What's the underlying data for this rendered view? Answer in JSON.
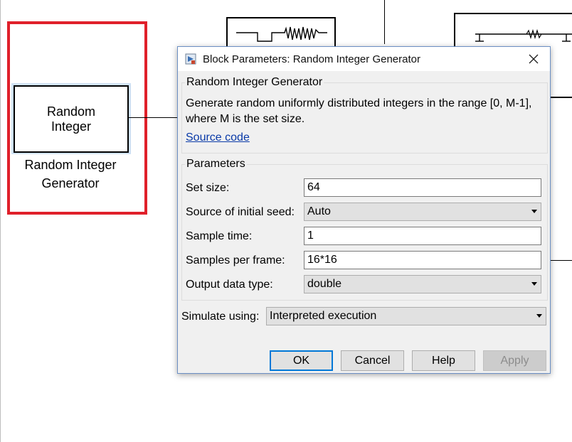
{
  "model_canvas": {
    "block": {
      "label": "Random\nInteger",
      "caption": "Random Integer\nGenerator"
    }
  },
  "dialog": {
    "title": "Block Parameters: Random Integer Generator",
    "block_name": "Random Integer Generator",
    "description": "Generate random uniformly distributed integers in the range [0, M-1], where M is the set size.",
    "source_link": "Source code",
    "parameters_label": "Parameters",
    "fields": {
      "set_size": {
        "label": "Set size:",
        "value": "64"
      },
      "initial_seed": {
        "label": "Source of initial seed:",
        "value": "Auto"
      },
      "sample_time": {
        "label": "Sample time:",
        "value": "1"
      },
      "samples_per_frame": {
        "label": "Samples per frame:",
        "value": "16*16"
      },
      "output_data_type": {
        "label": "Output data type:",
        "value": "double"
      }
    },
    "simulate_using": {
      "label": "Simulate using:",
      "value": "Interpreted execution"
    },
    "buttons": {
      "ok": "OK",
      "cancel": "Cancel",
      "help": "Help",
      "apply": "Apply"
    }
  },
  "colors": {
    "highlight": "#e0202a",
    "link": "#0a3aa8",
    "default_button_border": "#0078d7",
    "dialog_border": "#6b8fc4"
  }
}
